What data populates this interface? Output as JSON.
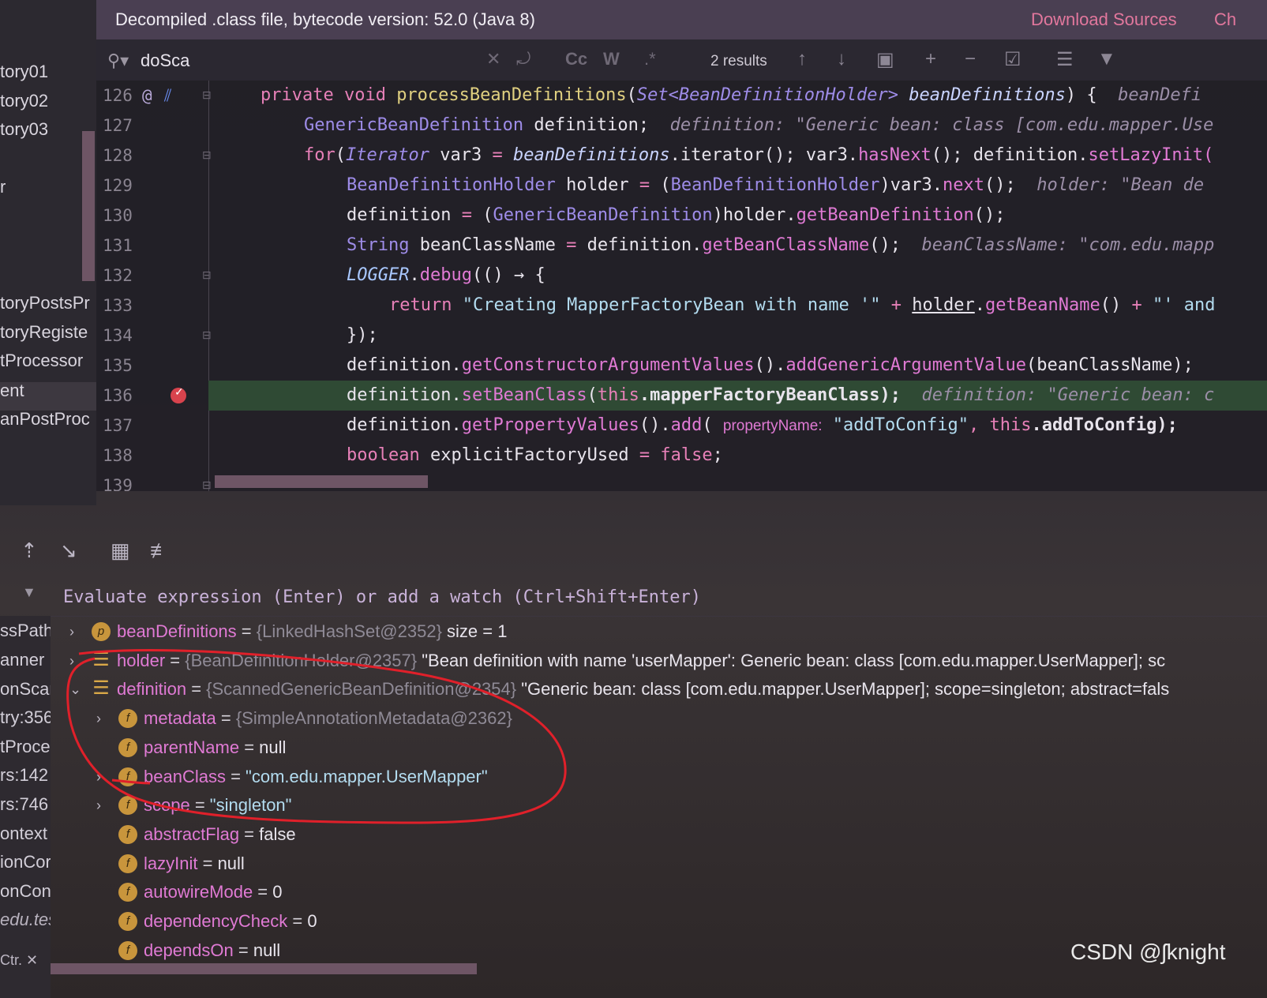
{
  "banner": {
    "text": "Decompiled .class file, bytecode version: 52.0 (Java 8)",
    "download": "Download Sources",
    "choose": "Ch"
  },
  "project_panel": {
    "items": [
      "tory01",
      "tory02",
      "tory03",
      "r",
      "toryPostsPr",
      "toryRegiste",
      "tProcessor",
      "ent",
      "anPostProc"
    ]
  },
  "search": {
    "value": "doSca",
    "results": "2 results",
    "opts": [
      "Cc",
      "W",
      ".*"
    ]
  },
  "editor": {
    "line_numbers": [
      "126",
      "127",
      "128",
      "129",
      "130",
      "131",
      "132",
      "133",
      "134",
      "135",
      "136",
      "137",
      "138",
      "139"
    ],
    "gutter_at": "@",
    "l126": {
      "kw": "private void ",
      "fn": "processBeanDefinitions",
      "p1": "(",
      "ty": "Set<BeanDefinitionHolder> ",
      "param": "beanDefinitions",
      "p2": ") {",
      "hint": "  beanDefi"
    },
    "l127": {
      "ty": "GenericBeanDefinition",
      "rest": " definition;",
      "hint": "  definition: \"Generic bean: class [com.edu.mapper.Use"
    },
    "l128": {
      "kw": "for",
      "p1": "(",
      "ty": "Iterator",
      "rest1": " var3 ",
      "op": "=",
      "sp": " ",
      "param": "beanDefinitions",
      "rest2": ".iterator(); var3.",
      "fn1": "hasNext",
      "rest3": "(); definition.",
      "fn2": "setLazyInit("
    },
    "l129": {
      "ty": "BeanDefinitionHolder",
      "rest1": " holder ",
      "op": "=",
      "sp": " (",
      "ty2": "BeanDefinitionHolder",
      "rest2": ")var3.",
      "fn": "next",
      "rest3": "();",
      "hint": "  holder: \"Bean de"
    },
    "l130": {
      "rest1": "definition ",
      "op": "=",
      "sp": " (",
      "ty": "GenericBeanDefinition",
      "rest2": ")holder.",
      "fn": "getBeanDefinition",
      "rest3": "();"
    },
    "l131": {
      "ty": "String",
      "rest1": " beanClassName ",
      "op": "=",
      "rest2": " definition.",
      "fn": "getBeanClassName",
      "rest3": "();",
      "hint": "  beanClassName: \"com.edu.mapp"
    },
    "l132": {
      "logger": "LOGGER",
      "rest1": ".",
      "fn": "debug",
      "rest2": "(() → {"
    },
    "l133": {
      "kw": "return",
      "sp": " ",
      "str": "\"Creating MapperFactoryBean with name '\"",
      "op": " + ",
      "u": "holder",
      "rest1": ".",
      "fn": "getBeanName",
      "rest2": "() ",
      "op2": "+",
      "str2": " \"' and"
    },
    "l134": {
      "rest": "});"
    },
    "l135": {
      "rest1": "definition.",
      "fn1": "getConstructorArgumentValues",
      "rest2": "().",
      "fn2": "addGenericArgumentValue",
      "rest3": "(beanClassName);"
    },
    "l136": {
      "rest1": "definition.",
      "fn": "setBeanClass",
      "rest2": "(",
      "kw": "this",
      "rest3": ".mapperFactoryBeanClass);",
      "hint": "  definition: \"Generic bean: c"
    },
    "l137": {
      "rest1": "definition.",
      "fn1": "getPropertyValues",
      "rest2": "().",
      "fn2": "add",
      "rest3": "( ",
      "pname": "propertyName:",
      "sp": " ",
      "str": "\"addToConfig\"",
      "comma": ", ",
      "kw": "this",
      "rest4": ".addToConfig);"
    },
    "l138": {
      "kw": "boolean",
      "rest1": " explicitFactoryUsed ",
      "op": "=",
      "sp": " ",
      "kw2": "false",
      "rest2": ";"
    }
  },
  "watch": {
    "placeholder": "Evaluate expression (Enter) or add a watch (Ctrl+Shift+Enter)"
  },
  "frames": {
    "items": [
      "ssPath",
      "anner",
      "onScar",
      "try:356",
      "tProce",
      "rs:142",
      "rs:746",
      "ontext",
      "ionCor",
      "onCont",
      "edu.tes"
    ],
    "bottom": "Ctr."
  },
  "variables": [
    {
      "name": "beanDefinitions",
      "ref": "{LinkedHashSet@2352}",
      "value": "size = 1",
      "icon": "p",
      "level": 0,
      "expandable": true
    },
    {
      "name": "holder",
      "ref": "{BeanDefinitionHolder@2357}",
      "value": "\"Bean definition with name 'userMapper': Generic bean: class [com.edu.mapper.UserMapper]; sc",
      "icon": "list",
      "level": 0,
      "expandable": true
    },
    {
      "name": "definition",
      "ref": "{ScannedGenericBeanDefinition@2354}",
      "value": "\"Generic bean: class [com.edu.mapper.UserMapper]; scope=singleton; abstract=fals",
      "icon": "list",
      "level": 0,
      "expandable": true,
      "expanded": true
    },
    {
      "name": "metadata",
      "ref": "{SimpleAnnotationMetadata@2362}",
      "value": "",
      "icon": "f",
      "level": 1,
      "expandable": true
    },
    {
      "name": "parentName",
      "ref": "",
      "value": "null",
      "icon": "f",
      "level": 1,
      "expandable": false
    },
    {
      "name": "beanClass",
      "ref": "",
      "value": "\"com.edu.mapper.UserMapper\"",
      "icon": "f",
      "level": 1,
      "expandable": true,
      "string": true
    },
    {
      "name": "scope",
      "ref": "",
      "value": "\"singleton\"",
      "icon": "f",
      "level": 1,
      "expandable": true,
      "string": true
    },
    {
      "name": "abstractFlag",
      "ref": "",
      "value": "false",
      "icon": "f",
      "level": 1,
      "expandable": false
    },
    {
      "name": "lazyInit",
      "ref": "",
      "value": "null",
      "icon": "f",
      "level": 1,
      "expandable": false
    },
    {
      "name": "autowireMode",
      "ref": "",
      "value": "0",
      "icon": "f",
      "level": 1,
      "expandable": false
    },
    {
      "name": "dependencyCheck",
      "ref": "",
      "value": "0",
      "icon": "f",
      "level": 1,
      "expandable": false
    },
    {
      "name": "dependsOn",
      "ref": "",
      "value": "null",
      "icon": "f",
      "level": 1,
      "expandable": false
    }
  ],
  "watermark": "CSDN @ʃknight",
  "colors": {
    "accent": "#e2779d",
    "keyword": "#e780b8",
    "type": "#9e8ce8",
    "string": "#b3dcf0",
    "annotation_red": "#e0202a"
  }
}
